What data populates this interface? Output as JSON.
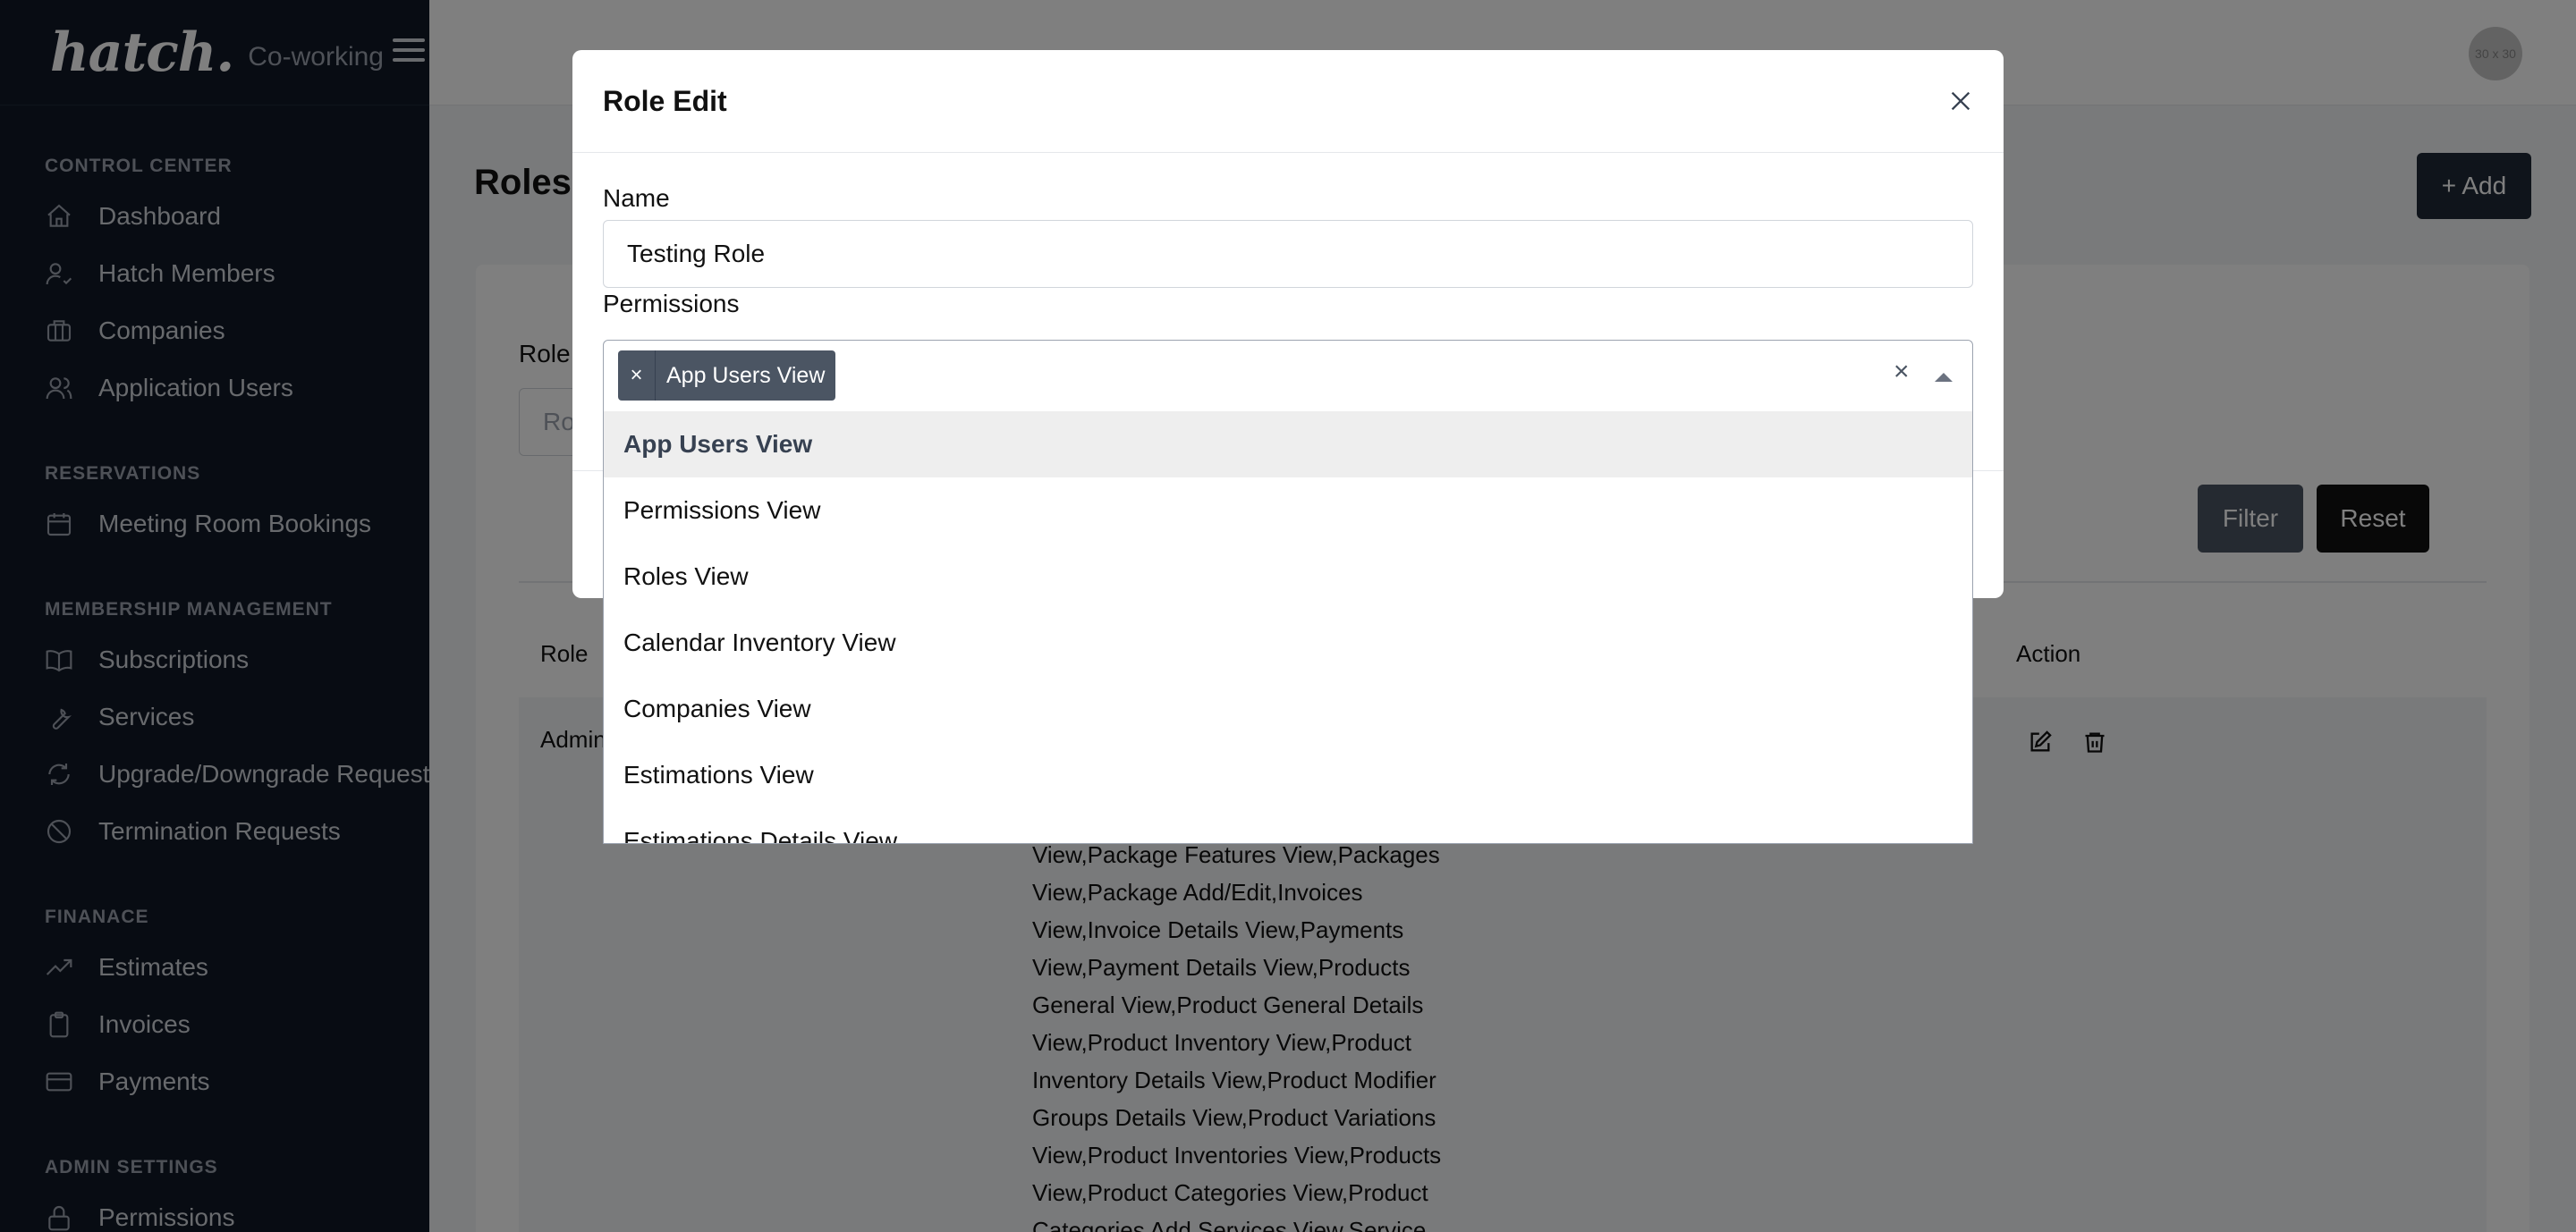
{
  "brand": {
    "logo": "hatch.",
    "subtitle": "Co-working"
  },
  "sidebar": {
    "sections": [
      {
        "title": "CONTROL CENTER",
        "items": [
          {
            "label": "Dashboard",
            "icon": "home-icon"
          },
          {
            "label": "Hatch Members",
            "icon": "user-check-icon"
          },
          {
            "label": "Companies",
            "icon": "briefcase-icon"
          },
          {
            "label": "Application Users",
            "icon": "users-icon"
          }
        ]
      },
      {
        "title": "RESERVATIONS",
        "items": [
          {
            "label": "Meeting Room Bookings",
            "icon": "calendar-icon"
          }
        ]
      },
      {
        "title": "MEMBERSHIP MANAGEMENT",
        "items": [
          {
            "label": "Subscriptions",
            "icon": "book-icon"
          },
          {
            "label": "Services",
            "icon": "wrench-icon"
          },
          {
            "label": "Upgrade/Downgrade Requests",
            "icon": "refresh-icon"
          },
          {
            "label": "Termination Requests",
            "icon": "ban-icon"
          }
        ]
      },
      {
        "title": "FINANACE",
        "items": [
          {
            "label": "Estimates",
            "icon": "trending-up-icon"
          },
          {
            "label": "Invoices",
            "icon": "clipboard-icon"
          },
          {
            "label": "Payments",
            "icon": "credit-card-icon"
          }
        ]
      },
      {
        "title": "ADMIN SETTINGS",
        "items": [
          {
            "label": "Permissions",
            "icon": "lock-icon"
          }
        ]
      }
    ]
  },
  "topbar": {
    "avatar_text": "30 x 30"
  },
  "page": {
    "title": "Roles",
    "add_button": "+ Add",
    "filter_label": "Role",
    "filter_placeholder": "Ro",
    "filter_button": "Filter",
    "reset_button": "Reset",
    "table": {
      "headers": {
        "role": "Role",
        "action": "Action"
      },
      "rows": [
        {
          "role": "Admin",
          "permissions": "View,Package Features View,Packages View,Package Add/Edit,Invoices View,Invoice Details View,Payments View,Payment Details View,Products General View,Product General Details View,Product Inventory View,Product Inventory Details View,Product Modifier Groups Details View,Product Variations View,Product Inventories View,Products View,Product Categories View,Product Categories Add,Services View,Service"
        }
      ]
    }
  },
  "modal": {
    "title": "Role Edit",
    "name_label": "Name",
    "name_value": "Testing Role",
    "permissions_label": "Permissions",
    "selected_tag": "App Users View",
    "tag_remove": "×",
    "clear_all": "×",
    "options": [
      "App Users View",
      "Permissions View",
      "Roles View",
      "Calendar Inventory View",
      "Companies View",
      "Estimations View",
      "Estimations Details View"
    ]
  }
}
